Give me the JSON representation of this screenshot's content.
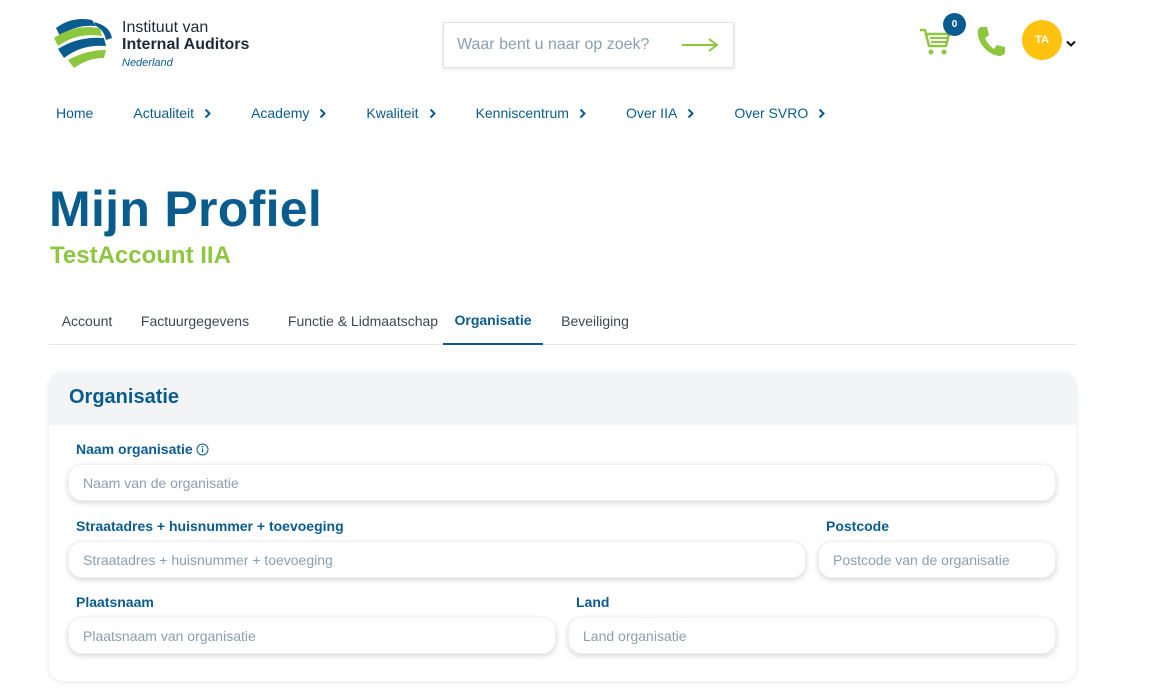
{
  "logo": {
    "line1": "Instituut van",
    "line2": "Internal Auditors",
    "line3": "Nederland"
  },
  "search": {
    "placeholder": "Waar bent u naar op zoek?"
  },
  "cart": {
    "count": "0"
  },
  "user": {
    "initials": "TA"
  },
  "colors": {
    "primary": "#0a5c8f",
    "accent": "#8dc63f",
    "avatar": "#ffc20e"
  },
  "nav": [
    {
      "label": "Home"
    },
    {
      "label": "Actualiteit"
    },
    {
      "label": "Academy"
    },
    {
      "label": "Kwaliteit"
    },
    {
      "label": "Kenniscentrum"
    },
    {
      "label": "Over IIA"
    },
    {
      "label": "Over SVRO"
    }
  ],
  "page": {
    "title": "Mijn Profiel",
    "subtitle": "TestAccount IIA"
  },
  "tabs": [
    {
      "label": "Account"
    },
    {
      "label": "Factuurgegevens"
    },
    {
      "label": "Functie & Lidmaatschap"
    },
    {
      "label": "Organisatie",
      "active": true
    },
    {
      "label": "Beveiliging"
    }
  ],
  "form": {
    "heading": "Organisatie",
    "org_name": {
      "label": "Naam organisatie",
      "placeholder": "Naam van de organisatie"
    },
    "street": {
      "label": "Straatadres + huisnummer + toevoeging",
      "placeholder": "Straatadres + huisnummer + toevoeging"
    },
    "postcode": {
      "label": "Postcode",
      "placeholder": "Postcode van de organisatie"
    },
    "city": {
      "label": "Plaatsnaam",
      "placeholder": "Plaatsnaam van organisatie"
    },
    "country": {
      "label": "Land",
      "placeholder": "Land organisatie"
    }
  }
}
